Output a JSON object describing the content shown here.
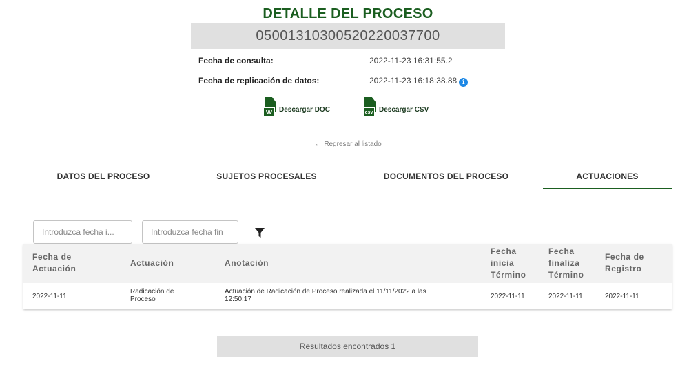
{
  "header": {
    "title": "DETALLE DEL PROCESO",
    "radicado": "05001310300520220037700"
  },
  "info": {
    "consulta_label": "Fecha de consulta:",
    "consulta_value": "2022-11-23 16:31:55.2",
    "replicacion_label": "Fecha de replicación de datos:",
    "replicacion_value": "2022-11-23 16:18:38.88",
    "info_icon": "i"
  },
  "downloads": {
    "doc_badge": "W",
    "doc_label": "Descargar DOC",
    "csv_badge": "csv",
    "csv_label": "Descargar CSV"
  },
  "back": {
    "arrow": "←",
    "label": "Regresar al listado"
  },
  "tabs": [
    {
      "label": "DATOS DEL PROCESO"
    },
    {
      "label": "SUJETOS PROCESALES"
    },
    {
      "label": "DOCUMENTOS DEL PROCESO"
    },
    {
      "label": "ACTUACIONES",
      "active": true
    }
  ],
  "filters": {
    "start_placeholder": "Introduzca fecha i...",
    "end_placeholder": "Introduzca fecha fin"
  },
  "table": {
    "columns": [
      {
        "line1": "Fecha de",
        "line2": "Actuación",
        "line3": ""
      },
      {
        "line1": "Actuación",
        "line2": "",
        "line3": ""
      },
      {
        "line1": "Anotación",
        "line2": "",
        "line3": ""
      },
      {
        "line1": "Fecha",
        "line2": "inicia",
        "line3": "Término"
      },
      {
        "line1": "Fecha",
        "line2": "finaliza",
        "line3": "Término"
      },
      {
        "line1": "Fecha de",
        "line2": "Registro",
        "line3": ""
      }
    ],
    "rows": [
      {
        "fecha_actuacion": "2022-11-11",
        "actuacion_1": "Radicación de",
        "actuacion_2": "Proceso",
        "anotacion_1": "Actuación de Radicación de Proceso realizada el 11/11/2022 a las",
        "anotacion_2": "12:50:17",
        "fecha_inicia": "2022-11-11",
        "fecha_finaliza": "2022-11-11",
        "fecha_registro": "2022-11-11"
      }
    ]
  },
  "results": "Resultados encontrados 1",
  "colors": {
    "brand_green": "#1b5e20",
    "info_blue": "#1e88e5",
    "header_gray": "#e0e0e0"
  }
}
